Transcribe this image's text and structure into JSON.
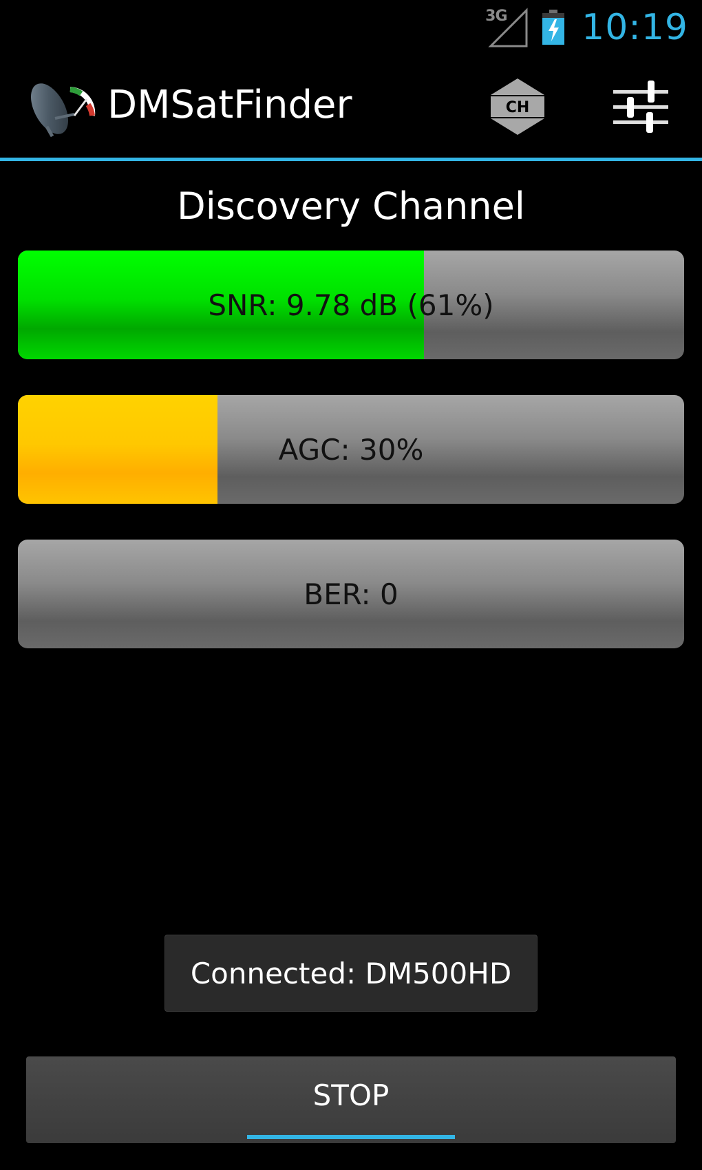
{
  "status_bar": {
    "network_type": "3G",
    "time": "10:19"
  },
  "action_bar": {
    "title": "DMSatFinder",
    "channel_button_label": "CH"
  },
  "channel": {
    "name": "Discovery Channel"
  },
  "meters": [
    {
      "id": "snr",
      "label": "SNR: 9.78 dB (61%)",
      "level_percent": 61,
      "fill_color": "#00e000"
    },
    {
      "id": "agc",
      "label": "AGC: 30%",
      "level_percent": 30,
      "fill_color": "#ffc000"
    },
    {
      "id": "ber",
      "label": "BER: 0",
      "level_percent": 0,
      "fill_color": "#00e000"
    }
  ],
  "toast": {
    "text": "Connected: DM500HD"
  },
  "stop_button": {
    "label": "STOP"
  },
  "colors": {
    "accent": "#33b5e5",
    "background": "#000000"
  },
  "icons": {
    "app": "satellite-dish-gauge-icon",
    "signal": "signal-strength-icon",
    "battery": "battery-charging-icon",
    "channel": "channel-up-down-icon",
    "settings": "sliders-settings-icon"
  }
}
